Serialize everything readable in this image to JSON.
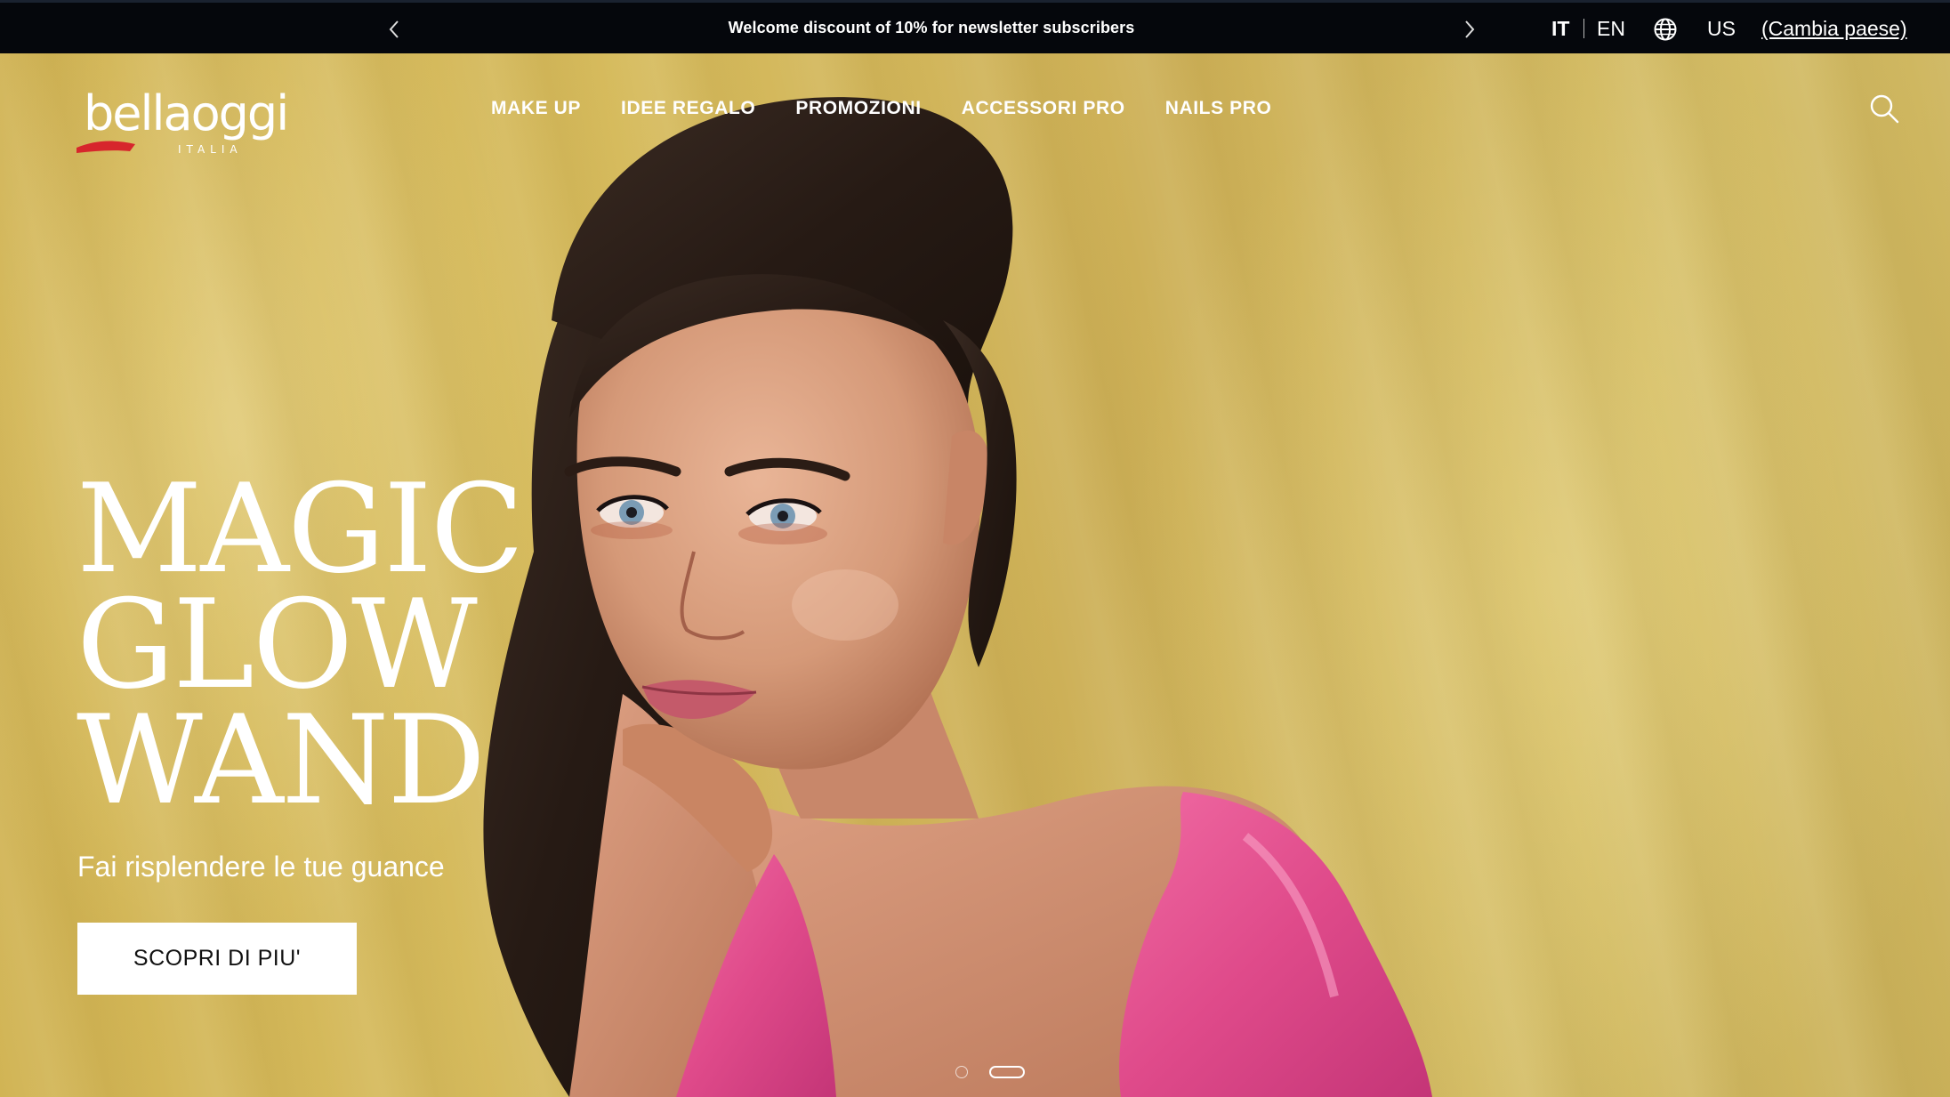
{
  "announcement": {
    "message": "Welcome discount of 10% for newsletter subscribers"
  },
  "locale": {
    "lang_it": "IT",
    "lang_en": "EN",
    "country": "US",
    "change_country": "(Cambia paese)"
  },
  "brand": {
    "name": "bellaoggi",
    "subtitle": "ITALIA",
    "accent_red": "#d7262c"
  },
  "nav": {
    "items": [
      "MAKE UP",
      "IDEE REGALO",
      "PROMOZIONI",
      "ACCESSORI PRO",
      "NAILS PRO"
    ]
  },
  "hero": {
    "title_lines": [
      "MAGIC",
      "GLOW",
      "WAND"
    ],
    "subtitle": "Fai risplendere le tue guance",
    "cta_label": "SCOPRI DI PIU'",
    "background_color": "#d2b65a",
    "dress_color": "#e0508e"
  },
  "carousel": {
    "slide_count": 2,
    "active_index": 1
  },
  "icons": {
    "prev": "chevron-left-icon",
    "next": "chevron-right-icon",
    "globe": "globe-icon",
    "search": "search-icon"
  }
}
